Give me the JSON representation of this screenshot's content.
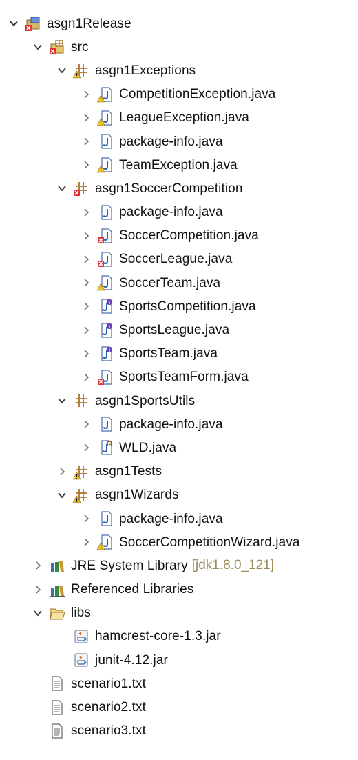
{
  "tree": [
    {
      "label": "asgn1Release",
      "depth": 0,
      "toggle": "expanded",
      "icon": "project-icon",
      "error": true
    },
    {
      "label": "src",
      "depth": 1,
      "toggle": "expanded",
      "icon": "source-folder-icon",
      "error": true
    },
    {
      "label": "asgn1Exceptions",
      "depth": 2,
      "toggle": "expanded",
      "icon": "package-icon",
      "warning": true
    },
    {
      "label": "CompetitionException.java",
      "depth": 3,
      "toggle": "collapsed",
      "icon": "java-file-icon",
      "warning": true
    },
    {
      "label": "LeagueException.java",
      "depth": 3,
      "toggle": "collapsed",
      "icon": "java-file-icon",
      "warning": true
    },
    {
      "label": "package-info.java",
      "depth": 3,
      "toggle": "collapsed",
      "icon": "java-file-icon"
    },
    {
      "label": "TeamException.java",
      "depth": 3,
      "toggle": "collapsed",
      "icon": "java-file-icon",
      "warning": true
    },
    {
      "label": "asgn1SoccerCompetition",
      "depth": 2,
      "toggle": "expanded",
      "icon": "package-icon",
      "error": true
    },
    {
      "label": "package-info.java",
      "depth": 3,
      "toggle": "collapsed",
      "icon": "java-file-icon"
    },
    {
      "label": "SoccerCompetition.java",
      "depth": 3,
      "toggle": "collapsed",
      "icon": "java-file-icon",
      "error": true
    },
    {
      "label": "SoccerLeague.java",
      "depth": 3,
      "toggle": "collapsed",
      "icon": "java-file-icon",
      "error": true
    },
    {
      "label": "SoccerTeam.java",
      "depth": 3,
      "toggle": "collapsed",
      "icon": "java-file-icon",
      "warning": true
    },
    {
      "label": "SportsCompetition.java",
      "depth": 3,
      "toggle": "collapsed",
      "icon": "java-interface-icon"
    },
    {
      "label": "SportsLeague.java",
      "depth": 3,
      "toggle": "collapsed",
      "icon": "java-interface-icon"
    },
    {
      "label": "SportsTeam.java",
      "depth": 3,
      "toggle": "collapsed",
      "icon": "java-interface-icon"
    },
    {
      "label": "SportsTeamForm.java",
      "depth": 3,
      "toggle": "collapsed",
      "icon": "java-file-icon",
      "error": true
    },
    {
      "label": "asgn1SportsUtils",
      "depth": 2,
      "toggle": "expanded",
      "icon": "package-icon"
    },
    {
      "label": "package-info.java",
      "depth": 3,
      "toggle": "collapsed",
      "icon": "java-file-icon"
    },
    {
      "label": "WLD.java",
      "depth": 3,
      "toggle": "collapsed",
      "icon": "java-enum-icon"
    },
    {
      "label": "asgn1Tests",
      "depth": 2,
      "toggle": "collapsed",
      "icon": "package-icon",
      "warning": true
    },
    {
      "label": "asgn1Wizards",
      "depth": 2,
      "toggle": "expanded",
      "icon": "package-icon",
      "warning": true
    },
    {
      "label": "package-info.java",
      "depth": 3,
      "toggle": "collapsed",
      "icon": "java-file-icon"
    },
    {
      "label": "SoccerCompetitionWizard.java",
      "depth": 3,
      "toggle": "collapsed",
      "icon": "java-file-icon",
      "warning": true
    },
    {
      "label": "JRE System Library",
      "decoration": "[jdk1.8.0_121]",
      "depth": 1,
      "toggle": "collapsed",
      "icon": "library-icon"
    },
    {
      "label": "Referenced Libraries",
      "depth": 1,
      "toggle": "collapsed",
      "icon": "library-icon"
    },
    {
      "label": "libs",
      "depth": 1,
      "toggle": "expanded",
      "icon": "folder-open-icon"
    },
    {
      "label": "hamcrest-core-1.3.jar",
      "depth": 2,
      "toggle": "none",
      "icon": "jar-icon"
    },
    {
      "label": "junit-4.12.jar",
      "depth": 2,
      "toggle": "none",
      "icon": "jar-icon"
    },
    {
      "label": "scenario1.txt",
      "depth": 1,
      "toggle": "none",
      "icon": "text-file-icon"
    },
    {
      "label": "scenario2.txt",
      "depth": 1,
      "toggle": "none",
      "icon": "text-file-icon"
    },
    {
      "label": "scenario3.txt",
      "depth": 1,
      "toggle": "none",
      "icon": "text-file-icon"
    }
  ],
  "colors": {
    "decoration": "#9a8a55",
    "error": "#e03030",
    "warning": "#f2c430",
    "package": "#b07a3a",
    "java_file": "#2a5db0",
    "interface": "#6a3fb8"
  }
}
